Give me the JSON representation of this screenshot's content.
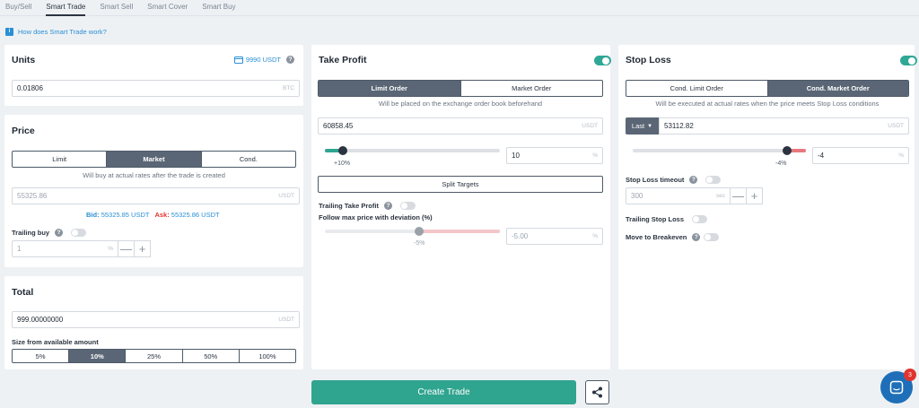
{
  "tabs": [
    "Buy/Sell",
    "Smart Trade",
    "Smart Sell",
    "Smart Cover",
    "Smart Buy"
  ],
  "help_link": "How does Smart Trade work?",
  "units": {
    "title": "Units",
    "balance": "9990 USDT",
    "value": "0.01806",
    "unit": "BTC"
  },
  "price": {
    "title": "Price",
    "modes": [
      "Limit",
      "Market",
      "Cond."
    ],
    "active_mode": "Market",
    "note": "Will buy at actual rates after the trade is created",
    "value": "55325.86",
    "unit": "USDT",
    "bid_label": "Bid:",
    "bid_value": "55325.85 USDT",
    "ask_label": "Ask:",
    "ask_value": "55325.86 USDT",
    "trailing_label": "Trailing buy",
    "trailing_value": "1",
    "trailing_unit": "%",
    "minus": "—",
    "plus": "+"
  },
  "total": {
    "title": "Total",
    "value": "999.00000000",
    "unit": "USDT",
    "size_label": "Size from available amount",
    "sizes": [
      "5%",
      "10%",
      "25%",
      "50%",
      "100%"
    ],
    "active_size": "10%"
  },
  "take_profit": {
    "title": "Take Profit",
    "enabled": true,
    "modes": [
      "Limit Order",
      "Market Order"
    ],
    "active_mode": "Limit Order",
    "note": "Will be placed on the exchange order book beforehand",
    "price": "60858.45",
    "unit": "USDT",
    "percent_label": "+10%",
    "percent_value": "10",
    "slider_fraction": 0.1,
    "percent_unit": "%",
    "split_label": "Split Targets",
    "trailing_label": "Trailing Take Profit",
    "follow_label": "Follow max price with deviation (%)",
    "deviation_label": "-5%",
    "deviation_value": "-5.00",
    "deviation_unit": "%"
  },
  "stop_loss": {
    "title": "Stop Loss",
    "enabled": true,
    "modes": [
      "Cond. Limit Order",
      "Cond. Market Order"
    ],
    "active_mode": "Cond. Market Order",
    "note": "Will be executed at actual rates when the price meets Stop Loss conditions",
    "price_type": "Last",
    "price": "53112.82",
    "unit": "USDT",
    "percent_label": "-4%",
    "percent_value": "-4",
    "percent_unit": "%",
    "timeout_label": "Stop Loss timeout",
    "timeout_value": "300",
    "timeout_unit": "sec",
    "trailing_label": "Trailing Stop Loss",
    "breakeven_label": "Move to Breakeven"
  },
  "create_button": "Create Trade",
  "chat_badge": "3",
  "colors": {
    "accent": "#2fa48f",
    "link": "#2a8fd4",
    "danger": "#e0342f"
  }
}
